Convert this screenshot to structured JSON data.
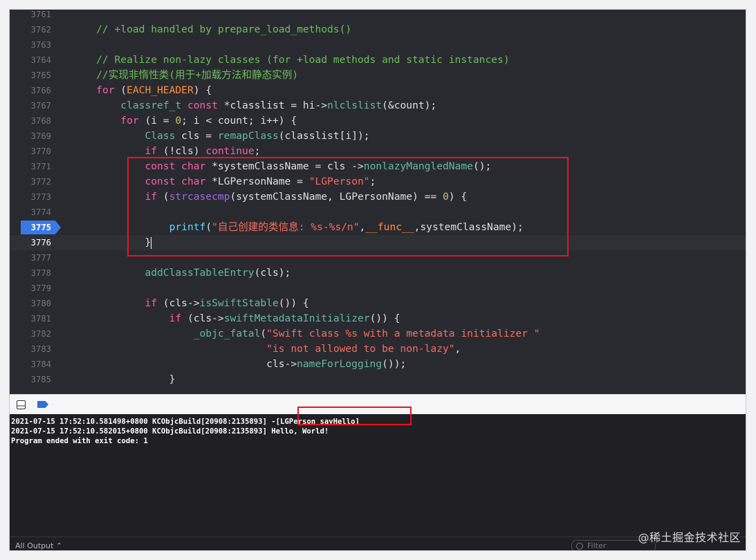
{
  "editor": {
    "current_line": "3776",
    "breakpoint_line": "3775",
    "lines": [
      {
        "n": "3761",
        "segs": []
      },
      {
        "n": "3762",
        "segs": [
          {
            "t": "    // +load handled by prepare_load_methods()",
            "c": "c-cmt"
          }
        ]
      },
      {
        "n": "3763",
        "segs": []
      },
      {
        "n": "3764",
        "segs": [
          {
            "t": "    // Realize non-lazy classes (for +load methods and static instances)",
            "c": "c-cmt"
          }
        ]
      },
      {
        "n": "3765",
        "segs": [
          {
            "t": "    //实现非惰性类(用于+加载方法和静态实例)",
            "c": "c-cmt"
          }
        ]
      },
      {
        "n": "3766",
        "segs": [
          {
            "t": "    ",
            "c": "c-plain"
          },
          {
            "t": "for",
            "c": "c-kw"
          },
          {
            "t": " (",
            "c": "c-plain"
          },
          {
            "t": "EACH_HEADER",
            "c": "c-mac"
          },
          {
            "t": ") {",
            "c": "c-plain"
          }
        ]
      },
      {
        "n": "3767",
        "segs": [
          {
            "t": "        ",
            "c": "c-plain"
          },
          {
            "t": "classref_t",
            "c": "c-fn"
          },
          {
            "t": " ",
            "c": "c-plain"
          },
          {
            "t": "const",
            "c": "c-kw"
          },
          {
            "t": " *classlist = hi->",
            "c": "c-plain"
          },
          {
            "t": "nlclslist",
            "c": "c-fn"
          },
          {
            "t": "(&count);",
            "c": "c-plain"
          }
        ]
      },
      {
        "n": "3768",
        "segs": [
          {
            "t": "        ",
            "c": "c-plain"
          },
          {
            "t": "for",
            "c": "c-kw"
          },
          {
            "t": " (i = ",
            "c": "c-plain"
          },
          {
            "t": "0",
            "c": "c-num"
          },
          {
            "t": "; i < count; i++) {",
            "c": "c-plain"
          }
        ]
      },
      {
        "n": "3769",
        "segs": [
          {
            "t": "            ",
            "c": "c-plain"
          },
          {
            "t": "Class",
            "c": "c-fn"
          },
          {
            "t": " cls = ",
            "c": "c-plain"
          },
          {
            "t": "remapClass",
            "c": "c-fn"
          },
          {
            "t": "(classlist[i]);",
            "c": "c-plain"
          }
        ]
      },
      {
        "n": "3770",
        "segs": [
          {
            "t": "            ",
            "c": "c-plain"
          },
          {
            "t": "if",
            "c": "c-kw"
          },
          {
            "t": " (!cls) ",
            "c": "c-plain"
          },
          {
            "t": "continue",
            "c": "c-kw"
          },
          {
            "t": ";",
            "c": "c-plain"
          }
        ]
      },
      {
        "n": "3771",
        "segs": [
          {
            "t": "            ",
            "c": "c-plain"
          },
          {
            "t": "const",
            "c": "c-kw"
          },
          {
            "t": " ",
            "c": "c-plain"
          },
          {
            "t": "char",
            "c": "c-kw"
          },
          {
            "t": " *systemClassName = cls ->",
            "c": "c-plain"
          },
          {
            "t": "nonlazyMangledName",
            "c": "c-fn"
          },
          {
            "t": "();",
            "c": "c-plain"
          }
        ]
      },
      {
        "n": "3772",
        "segs": [
          {
            "t": "            ",
            "c": "c-plain"
          },
          {
            "t": "const",
            "c": "c-kw"
          },
          {
            "t": " ",
            "c": "c-plain"
          },
          {
            "t": "char",
            "c": "c-kw"
          },
          {
            "t": " *LGPersonName = ",
            "c": "c-plain"
          },
          {
            "t": "\"LGPerson\"",
            "c": "c-str"
          },
          {
            "t": ";",
            "c": "c-plain"
          }
        ]
      },
      {
        "n": "3773",
        "segs": [
          {
            "t": "            ",
            "c": "c-plain"
          },
          {
            "t": "if",
            "c": "c-kw"
          },
          {
            "t": " (",
            "c": "c-plain"
          },
          {
            "t": "strcasecmp",
            "c": "c-fn2"
          },
          {
            "t": "(systemClassName, LGPersonName) == ",
            "c": "c-plain"
          },
          {
            "t": "0",
            "c": "c-num"
          },
          {
            "t": ") {",
            "c": "c-plain"
          }
        ]
      },
      {
        "n": "3774",
        "segs": []
      },
      {
        "n": "3775",
        "segs": [
          {
            "t": "                ",
            "c": "c-plain"
          },
          {
            "t": "printf",
            "c": "c-type"
          },
          {
            "t": "(",
            "c": "c-plain"
          },
          {
            "t": "\"自己创建的类信息: %s-%s/n\"",
            "c": "c-str"
          },
          {
            "t": ",",
            "c": "c-plain"
          },
          {
            "t": "__func__",
            "c": "c-mac"
          },
          {
            "t": ",systemClassName);",
            "c": "c-plain"
          }
        ]
      },
      {
        "n": "3776",
        "segs": [
          {
            "t": "            }",
            "c": "c-plain"
          }
        ]
      },
      {
        "n": "3777",
        "segs": []
      },
      {
        "n": "3778",
        "segs": [
          {
            "t": "            ",
            "c": "c-plain"
          },
          {
            "t": "addClassTableEntry",
            "c": "c-fn"
          },
          {
            "t": "(cls);",
            "c": "c-plain"
          }
        ]
      },
      {
        "n": "3779",
        "segs": []
      },
      {
        "n": "3780",
        "segs": [
          {
            "t": "            ",
            "c": "c-plain"
          },
          {
            "t": "if",
            "c": "c-kw"
          },
          {
            "t": " (cls->",
            "c": "c-plain"
          },
          {
            "t": "isSwiftStable",
            "c": "c-fn"
          },
          {
            "t": "()) {",
            "c": "c-plain"
          }
        ]
      },
      {
        "n": "3781",
        "segs": [
          {
            "t": "                ",
            "c": "c-plain"
          },
          {
            "t": "if",
            "c": "c-kw"
          },
          {
            "t": " (cls->",
            "c": "c-plain"
          },
          {
            "t": "swiftMetadataInitializer",
            "c": "c-fn"
          },
          {
            "t": "()) {",
            "c": "c-plain"
          }
        ]
      },
      {
        "n": "3782",
        "segs": [
          {
            "t": "                    ",
            "c": "c-plain"
          },
          {
            "t": "_objc_fatal",
            "c": "c-fn"
          },
          {
            "t": "(",
            "c": "c-plain"
          },
          {
            "t": "\"Swift class %s with a metadata initializer \"",
            "c": "c-str"
          }
        ]
      },
      {
        "n": "3783",
        "segs": [
          {
            "t": "                                ",
            "c": "c-plain"
          },
          {
            "t": "\"is not allowed to be non-lazy\"",
            "c": "c-str"
          },
          {
            "t": ",",
            "c": "c-plain"
          }
        ]
      },
      {
        "n": "3784",
        "segs": [
          {
            "t": "                                ",
            "c": "c-plain"
          },
          {
            "t": "cls->",
            "c": "c-plain"
          },
          {
            "t": "nameForLogging",
            "c": "c-fn"
          },
          {
            "t": "());",
            "c": "c-plain"
          }
        ]
      },
      {
        "n": "3785",
        "segs": [
          {
            "t": "                }",
            "c": "c-plain"
          }
        ]
      }
    ]
  },
  "console": {
    "lines": [
      "2021-07-15 17:52:10.581498+0800 KCObjcBuild[20908:2135893] -[LGPerson sayHello]",
      "2021-07-15 17:52:10.582015+0800 KCObjcBuild[20908:2135893] Hello, World!",
      "Program ended with exit code: 1"
    ]
  },
  "status": {
    "output_selector": "All Output ⌃",
    "filter_placeholder": "Filter"
  },
  "watermark": "@稀土掘金技术社区",
  "colors": {
    "editor_bg": "#292a30",
    "console_bg": "#1f1f24",
    "highlight_box": "#e8141e",
    "breakpoint": "#3a78e6"
  }
}
